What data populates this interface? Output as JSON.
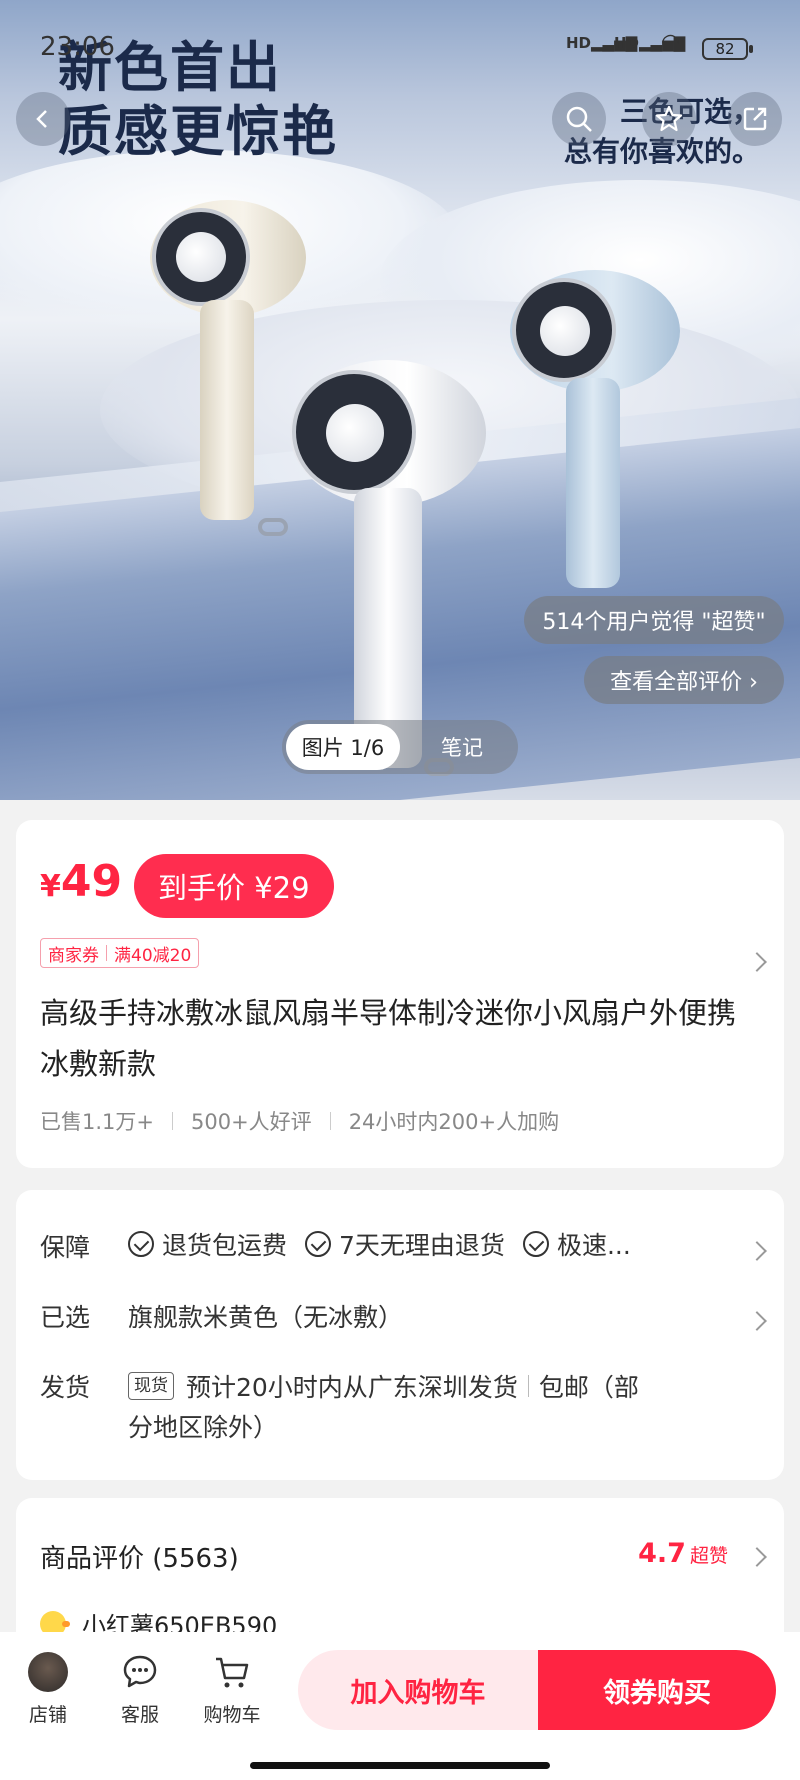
{
  "status_bar": {
    "time": "23:06",
    "signal1": "HD",
    "signal2": "HD",
    "battery": "82"
  },
  "hero": {
    "headline_line1": "新色首出",
    "headline_line2": "质感更惊艳",
    "sub_line1": "三色可选，",
    "sub_line2": "总有你喜欢的。",
    "praise_badge": "514个用户觉得 \"超赞\"",
    "view_all_reviews": "查看全部评价 ›",
    "tab_images": "图片 1/6",
    "tab_notes": "笔记"
  },
  "product": {
    "price_symbol": "¥",
    "price": "49",
    "final_price": "到手价 ¥29",
    "coupon_label": "商家券",
    "coupon_value": "满40减20",
    "title": "高级手持冰敷冰鼠风扇半导体制冷迷你小风扇户外便携冰敷新款",
    "sold": "已售1.1万+",
    "good_reviews": "500+人好评",
    "recent_adds": "24小时内200+人加购"
  },
  "info": {
    "guarantee_label": "保障",
    "guarantee_items": [
      "退货包运费",
      "7天无理由退货",
      "极速..."
    ],
    "selected_label": "已选",
    "selected_value": "旗舰款米黄色（无冰敷）",
    "shipping_label": "发货",
    "shipping_tag": "现货",
    "shipping_line1": "预计20小时内从广东深圳发货",
    "shipping_free": "包邮（部",
    "shipping_line2": "分地区除外）"
  },
  "reviews": {
    "title": "商品评价 (5563)",
    "score": "4.7",
    "score_word": "超赞",
    "first_reviewer": "小红薯650EB590"
  },
  "bottom_bar": {
    "store": "店铺",
    "service": "客服",
    "cart": "购物车",
    "add_to_cart": "加入购物车",
    "buy_with_coupon": "领券购买"
  },
  "colors": {
    "accent": "#ff2442",
    "accent_light": "#ffe9ec",
    "card_bg": "#ffffff",
    "page_bg": "#f2f2f2"
  }
}
